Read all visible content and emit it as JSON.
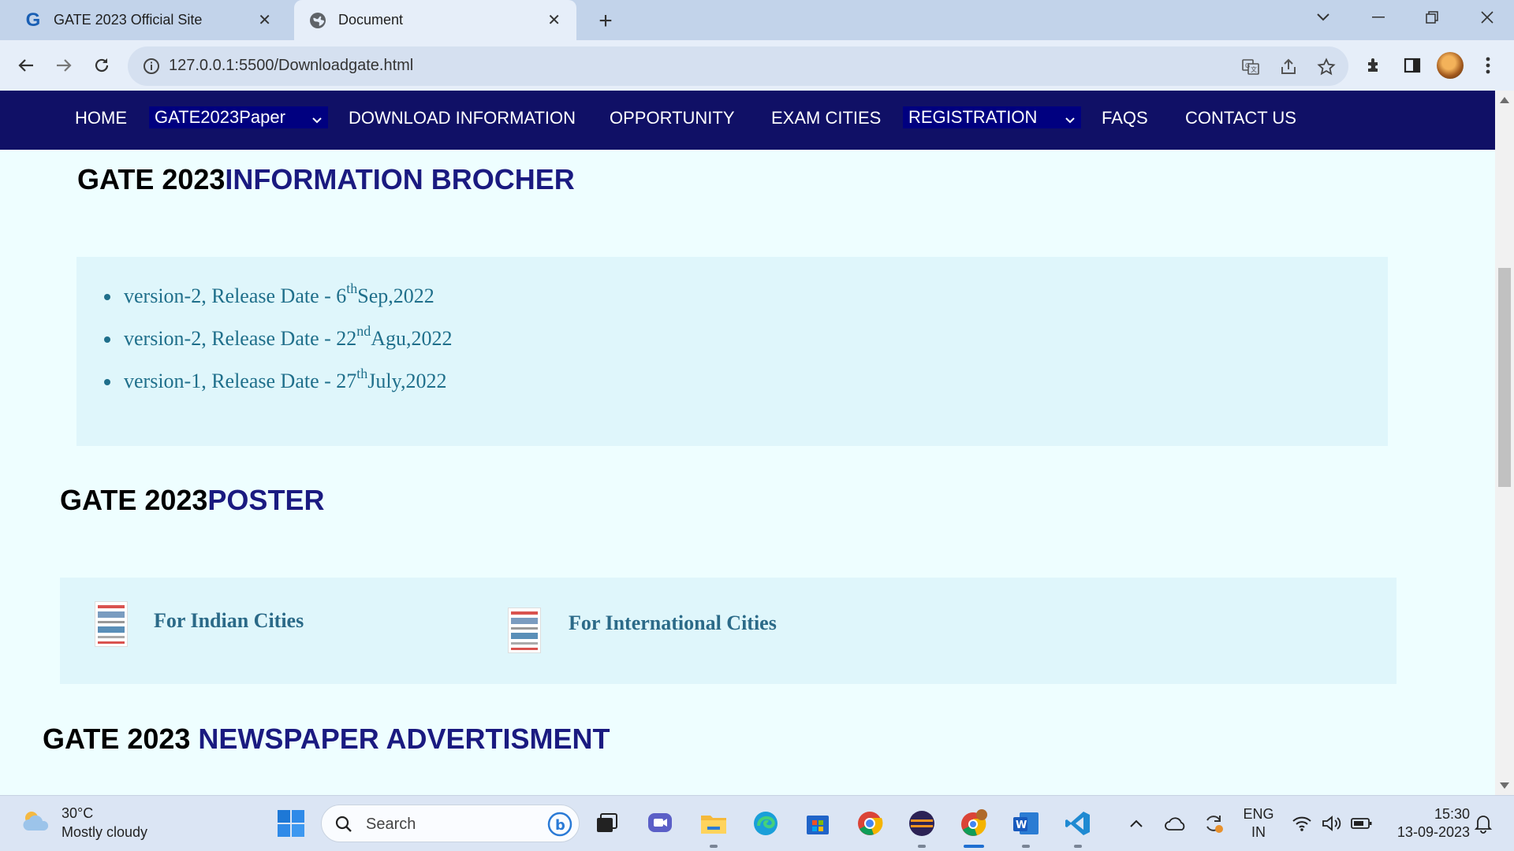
{
  "browser": {
    "tabs": [
      {
        "title": "GATE 2023 Official Site",
        "favicon": "gate-g-logo"
      },
      {
        "title": "Document",
        "favicon": "globe-icon"
      }
    ],
    "url": "127.0.0.1:5500/Downloadgate.html"
  },
  "nav": {
    "home": "HOME",
    "paper_select": "GATE2023Paper",
    "download": "DOWNLOAD INFORMATION",
    "opportunity": "OPPORTUNITY",
    "exam_cities": "EXAM CITIES",
    "registration_select": "REGISTRATION",
    "faqs": "FAQS",
    "contact": "CONTACT US"
  },
  "brochure": {
    "title_prefix": "GATE 2023",
    "title_accent": "INFORMATION BROCHER",
    "items": [
      {
        "text": "version-2, Release Date - 6",
        "sup": "th",
        "suffix": "Sep,2022"
      },
      {
        "text": "version-2, Release Date - 22",
        "sup": "nd",
        "suffix": "Agu,2022"
      },
      {
        "text": "version-1, Release Date - 27",
        "sup": "th",
        "suffix": "July,2022"
      }
    ]
  },
  "poster": {
    "title_prefix": "GATE 2023",
    "title_accent": "POSTER",
    "links": [
      "For Indian Cities",
      "For International Cities"
    ]
  },
  "newspaper": {
    "title_prefix": "GATE 2023 ",
    "title_accent": "NEWSPAPER ADVERTISMENT"
  },
  "taskbar": {
    "weather_temp": "30°C",
    "weather_desc": "Mostly cloudy",
    "search_label": "Search",
    "lang_1": "ENG",
    "lang_2": "IN",
    "time": "15:30",
    "date": "13-09-2023"
  },
  "colors": {
    "nav_bg": "#101066",
    "accent": "#1a1a80",
    "page_bg": "#eefeff",
    "panel_bg": "#dff6fb",
    "list_text": "#1f6f8b"
  }
}
